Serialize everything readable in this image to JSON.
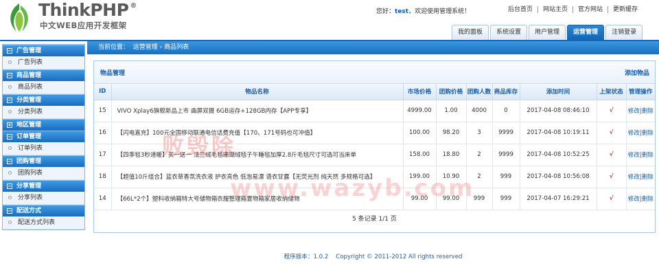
{
  "header": {
    "brand": "ThinkPHP",
    "brand_reg": "®",
    "brand_sub": "中文WEB应用开发框架",
    "greeting_prefix": "您好：",
    "username": "test",
    "greeting_suffix": "，欢迎使用管理系统！",
    "links": [
      "后台首页",
      "网站主页",
      "官方网站",
      "更新缓存"
    ],
    "tabs": [
      "我的面板",
      "系统设置",
      "用户管理",
      "运营管理",
      "注销登录"
    ]
  },
  "sidebar": {
    "groups": [
      {
        "title": "广告管理",
        "items": [
          "广告列表"
        ]
      },
      {
        "title": "商品管理",
        "items": [
          "商品列表"
        ]
      },
      {
        "title": "分类管理",
        "items": [
          "分类列表"
        ]
      },
      {
        "title": "地区管理",
        "items": []
      },
      {
        "title": "订单管理",
        "items": [
          "订单列表"
        ]
      },
      {
        "title": "团购管理",
        "items": [
          "团购列表"
        ]
      },
      {
        "title": "分享管理",
        "items": [
          "分享列表"
        ]
      },
      {
        "title": "配送方式",
        "items": [
          "配送方式列表"
        ]
      }
    ]
  },
  "breadcrumb": {
    "prefix": "当前位置：",
    "level1": "运营管理",
    "sep": "›",
    "level2": "商品列表"
  },
  "panel": {
    "title": "物品管理",
    "add_label": "添加物品",
    "columns": [
      "ID",
      "物品名称",
      "市场价格",
      "团购价格",
      "团购人数",
      "商品库存",
      "添加时间",
      "上架状态",
      "管理操作"
    ],
    "rows": [
      {
        "id": "15",
        "name": "VIVO Xplay6旗舰新品上市 曲屏双摄 6GB运存+128GB内存【APP专享】",
        "market": "4999.00",
        "group_price": "1.00",
        "group_count": "4000",
        "stock": "0",
        "time": "2017-04-08 08:46:10",
        "status": "√",
        "edit": "修改",
        "del": "|删除"
      },
      {
        "id": "16",
        "name": "【闪电直充】100元全国移动联通电信话费充值【170、171号码也可冲值】",
        "market": "100.00",
        "group_price": "98.20",
        "group_count": "3",
        "stock": "9999",
        "time": "2017-04-08 10:19:11",
        "status": "√",
        "edit": "修改",
        "del": "|删除"
      },
      {
        "id": "17",
        "name": "【四季毯3秒速暖】买一送一 法兰绒毛毯珊瑚绒毯子午睡毯加厚2.8斤毛毯尺寸可选可当床单",
        "market": "158.00",
        "group_price": "18.80",
        "group_count": "2",
        "stock": "9999",
        "time": "2017-04-08 10:52:25",
        "status": "√",
        "edit": "修改",
        "del": "|删除"
      },
      {
        "id": "18",
        "name": "【超值10斤组合】蓝衣草香氛洗衣液 护衣亮色 低泡易漂 语衣甘露【无荧光剂 纯天然 多规格可选】",
        "market": "199.00",
        "group_price": "10.90",
        "group_count": "2",
        "stock": "999",
        "time": "2017-04-08 10:56:08",
        "status": "√",
        "edit": "修改",
        "del": "|删除"
      },
      {
        "id": "14",
        "name": "【66L*2个】塑料收纳箱特大号储物箱衣服整理箱置物箱家居收纳储物",
        "market": "99.00",
        "group_price": "99.00",
        "group_count": "999",
        "stock": "999",
        "time": "2017-04-07 16:29:21",
        "status": "√",
        "edit": "修改",
        "del": "|删除"
      }
    ],
    "pager": "5 条记录 1/1 页"
  },
  "footer": {
    "version": "程序版本：1.0.2",
    "copyright": "Copyright © 2011-2012 All rights reserved"
  },
  "watermark": {
    "text1": "败毁除",
    "text2": "www.wazyb.com"
  },
  "colors": {
    "brand_blue": "#1768b4",
    "link_blue": "#1a5ea8",
    "status_red": "#e01e1e"
  }
}
